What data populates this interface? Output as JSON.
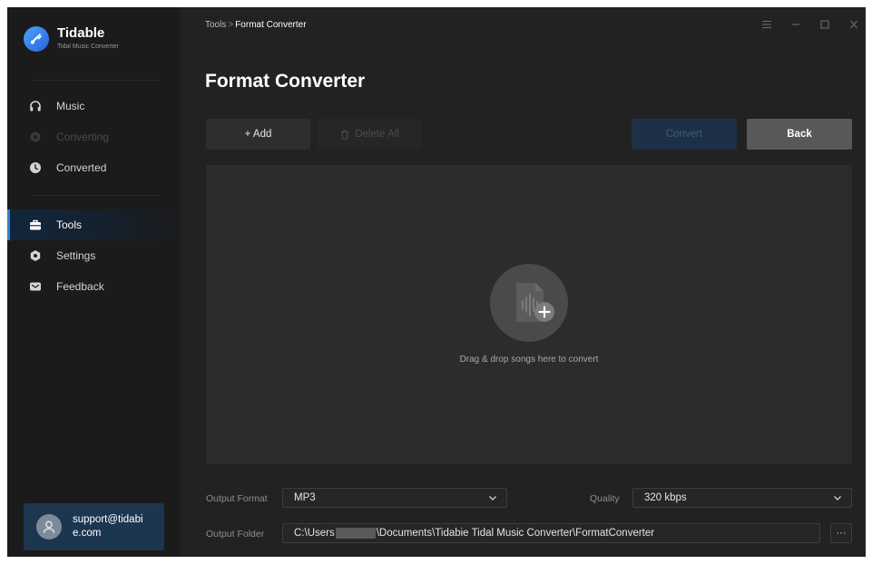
{
  "app": {
    "name": "Tidable",
    "subtitle": "Tidal Music Converter"
  },
  "sidebar": {
    "items": [
      {
        "label": "Music",
        "icon": "headphones-icon"
      },
      {
        "label": "Converting",
        "icon": "converting-icon"
      },
      {
        "label": "Converted",
        "icon": "clock-icon"
      },
      {
        "label": "Tools",
        "icon": "toolbox-icon"
      },
      {
        "label": "Settings",
        "icon": "gear-icon"
      },
      {
        "label": "Feedback",
        "icon": "mail-icon"
      }
    ],
    "account": {
      "email": "support@tidabie.com"
    }
  },
  "header": {
    "breadcrumb": {
      "root": "Tools",
      "separator": ">",
      "current": "Format Converter"
    },
    "title": "Format Converter",
    "window_controls": [
      "menu-icon",
      "minimize-icon",
      "maximize-icon",
      "close-icon"
    ]
  },
  "toolbar": {
    "add_label": "+ Add",
    "delete_all_label": "Delete All",
    "convert_label": "Convert",
    "back_label": "Back"
  },
  "dropzone": {
    "text": "Drag & drop songs here to convert"
  },
  "output": {
    "format_label": "Output Format",
    "format_value": "MP3",
    "quality_label": "Quality",
    "quality_value": "320 kbps",
    "folder_label": "Output Folder",
    "folder_prefix": "C:\\Users",
    "folder_suffix": "\\Documents\\Tidabie Tidal Music Converter\\FormatConverter",
    "browse_label": "···"
  },
  "colors": {
    "accent": "#2f7dd6",
    "background": "#222222",
    "sidebar": "#1b1b1b",
    "back_button": "#585858"
  }
}
